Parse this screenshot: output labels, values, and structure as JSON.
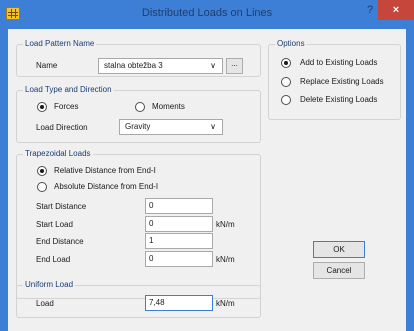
{
  "window": {
    "title": "Distributed Loads on Lines",
    "help_glyph": "?",
    "close_glyph": "×"
  },
  "load_pattern": {
    "legend": "Load Pattern Name",
    "name_label": "Name",
    "name_value": "stalna obtežba 3",
    "browse_label": "..."
  },
  "load_type": {
    "legend": "Load Type and Direction",
    "forces_label": "Forces",
    "forces_selected": true,
    "moments_label": "Moments",
    "moments_selected": false,
    "direction_label": "Load Direction",
    "direction_value": "Gravity"
  },
  "trapezoidal": {
    "legend": "Trapezoidal Loads",
    "relative_label": "Relative Distance from End-I",
    "relative_selected": true,
    "absolute_label": "Absolute Distance from End-I",
    "absolute_selected": false,
    "start_distance_label": "Start Distance",
    "start_distance_value": "0",
    "start_load_label": "Start Load",
    "start_load_value": "0",
    "start_load_unit": "kN/m",
    "end_distance_label": "End Distance",
    "end_distance_value": "1",
    "end_load_label": "End Load",
    "end_load_value": "0",
    "end_load_unit": "kN/m"
  },
  "uniform": {
    "legend": "Uniform Load",
    "load_label": "Load",
    "load_value": "7,48",
    "load_unit": "kN/m"
  },
  "options": {
    "legend": "Options",
    "add_label": "Add to Existing Loads",
    "add_selected": true,
    "replace_label": "Replace Existing Loads",
    "replace_selected": false,
    "delete_label": "Delete Existing Loads",
    "delete_selected": false
  },
  "buttons": {
    "ok_label": "OK",
    "cancel_label": "Cancel"
  },
  "icons": {
    "app": "grid-app-icon",
    "dropdown": "chevron-down-icon"
  }
}
